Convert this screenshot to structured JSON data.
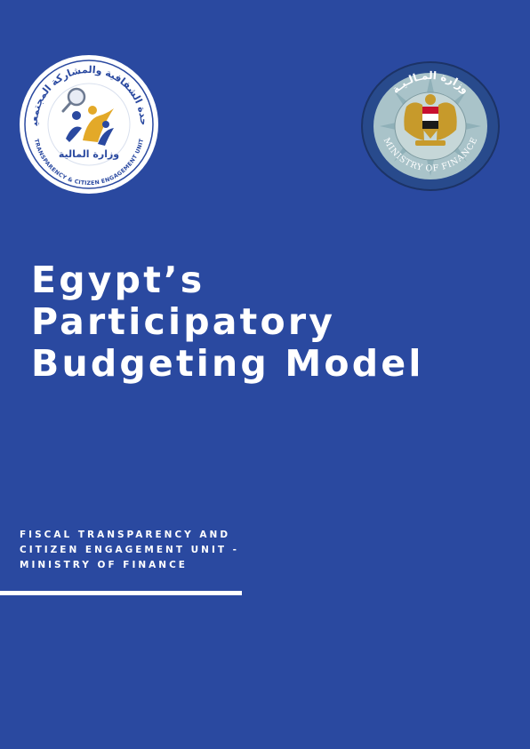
{
  "logos": {
    "left": {
      "arabic_text": "وحدة الشفافية والمشاركة المجتمعية",
      "english_text": "TRANSPARENCY & CITIZEN ENGAGEMENT UNIT",
      "arabic_center": "وزارة المالية",
      "colors": {
        "ring": "#ffffff",
        "inner": "#2a49a0",
        "accent": "#e3a928"
      }
    },
    "right": {
      "arabic_text": "وزارة المـالـيـة",
      "english_text": "MINISTRY OF FINANCE",
      "colors": {
        "ring": "#284a8c",
        "inner": "#a9c3c9",
        "eagle": "#c79a2b",
        "red": "#c8102e"
      }
    }
  },
  "title": {
    "line1": "Egypt’s",
    "line2": "Participatory",
    "line3": "Budgeting Model"
  },
  "subtitle": {
    "line1": "FISCAL TRANSPARENCY AND",
    "line2": "CITIZEN ENGAGEMENT UNIT -",
    "line3": "MINISTRY OF FINANCE"
  },
  "colors": {
    "background": "#2a49a0",
    "text": "#ffffff"
  }
}
